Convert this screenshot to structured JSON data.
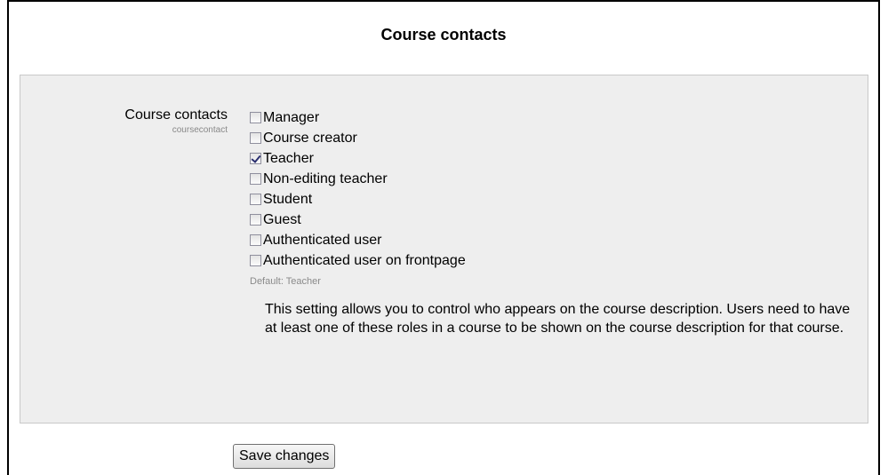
{
  "page": {
    "heading": "Course contacts"
  },
  "setting": {
    "label": "Course contacts",
    "key": "coursecontact",
    "options": [
      {
        "label": "Manager",
        "checked": false
      },
      {
        "label": "Course creator",
        "checked": false
      },
      {
        "label": "Teacher",
        "checked": true
      },
      {
        "label": "Non-editing teacher",
        "checked": false
      },
      {
        "label": "Student",
        "checked": false
      },
      {
        "label": "Guest",
        "checked": false
      },
      {
        "label": "Authenticated user",
        "checked": false
      },
      {
        "label": "Authenticated user on frontpage",
        "checked": false
      }
    ],
    "default_note": "Default: Teacher",
    "description": "This setting allows you to control who appears on the course description. Users need to have at least one of these roles in a course to be shown on the course description for that course."
  },
  "actions": {
    "save_label": "Save changes"
  }
}
